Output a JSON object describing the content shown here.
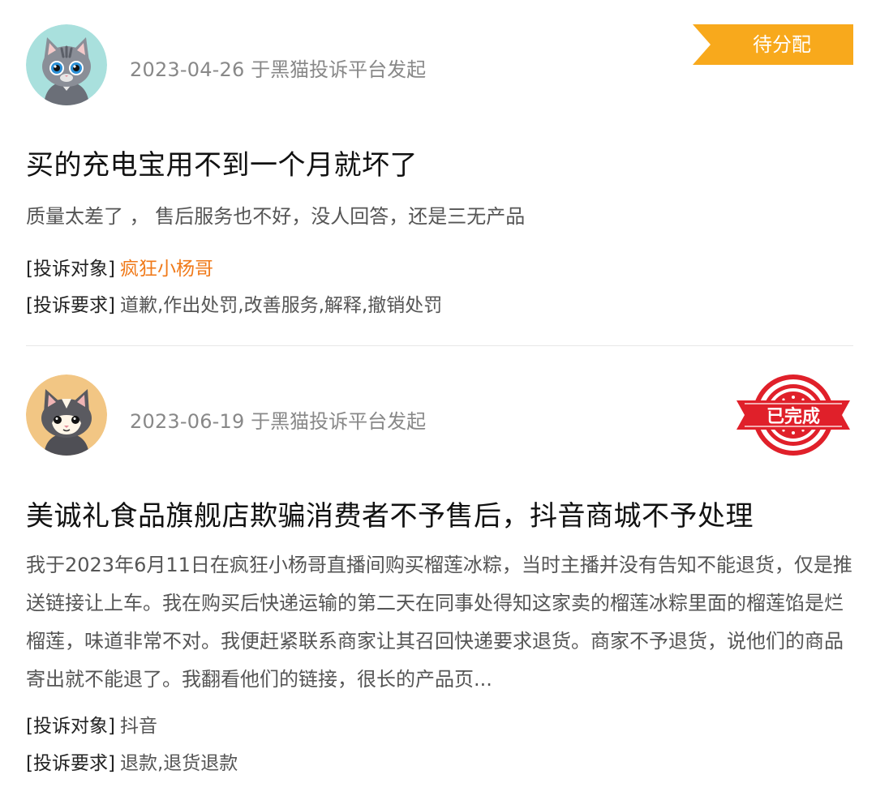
{
  "complaints": [
    {
      "date": "2023-04-26",
      "source": "于黑猫投诉平台发起",
      "status": "待分配",
      "title": "买的充电宝用不到一个月就坏了",
      "description": "质量太差了 ，  售后服务也不好，没人回答，还是三无产品",
      "target_label": "[投诉对象]",
      "target_value": "疯狂小杨哥",
      "demand_label": "[投诉要求]",
      "demand_value": "道歉,作出处罚,改善服务,解释,撤销处罚",
      "avatar": "gray-cat-avatar",
      "status_color": "#f8a91c"
    },
    {
      "date": "2023-06-19",
      "source": "于黑猫投诉平台发起",
      "status": "已完成",
      "title": "美诚礼食品旗舰店欺骗消费者不予售后，抖音商城不予处理",
      "description": "我于2023年6月11日在疯狂小杨哥直播间购买榴莲冰粽，当时主播并没有告知不能退货，仅是推送链接让上车。我在购买后快递运输的第二天在同事处得知这家卖的榴莲冰粽里面的榴莲馅是烂榴莲，味道非常不对。我便赶紧联系商家让其召回快递要求退货。商家不予退货，说他们的商品寄出就不能退了。我翻看他们的链接，很长的产品页...",
      "target_label": "[投诉对象]",
      "target_value": "抖音",
      "demand_label": "[投诉要求]",
      "demand_value": "退款,退货退款",
      "avatar": "cream-cat-avatar",
      "status_color": "#e0202a"
    }
  ]
}
